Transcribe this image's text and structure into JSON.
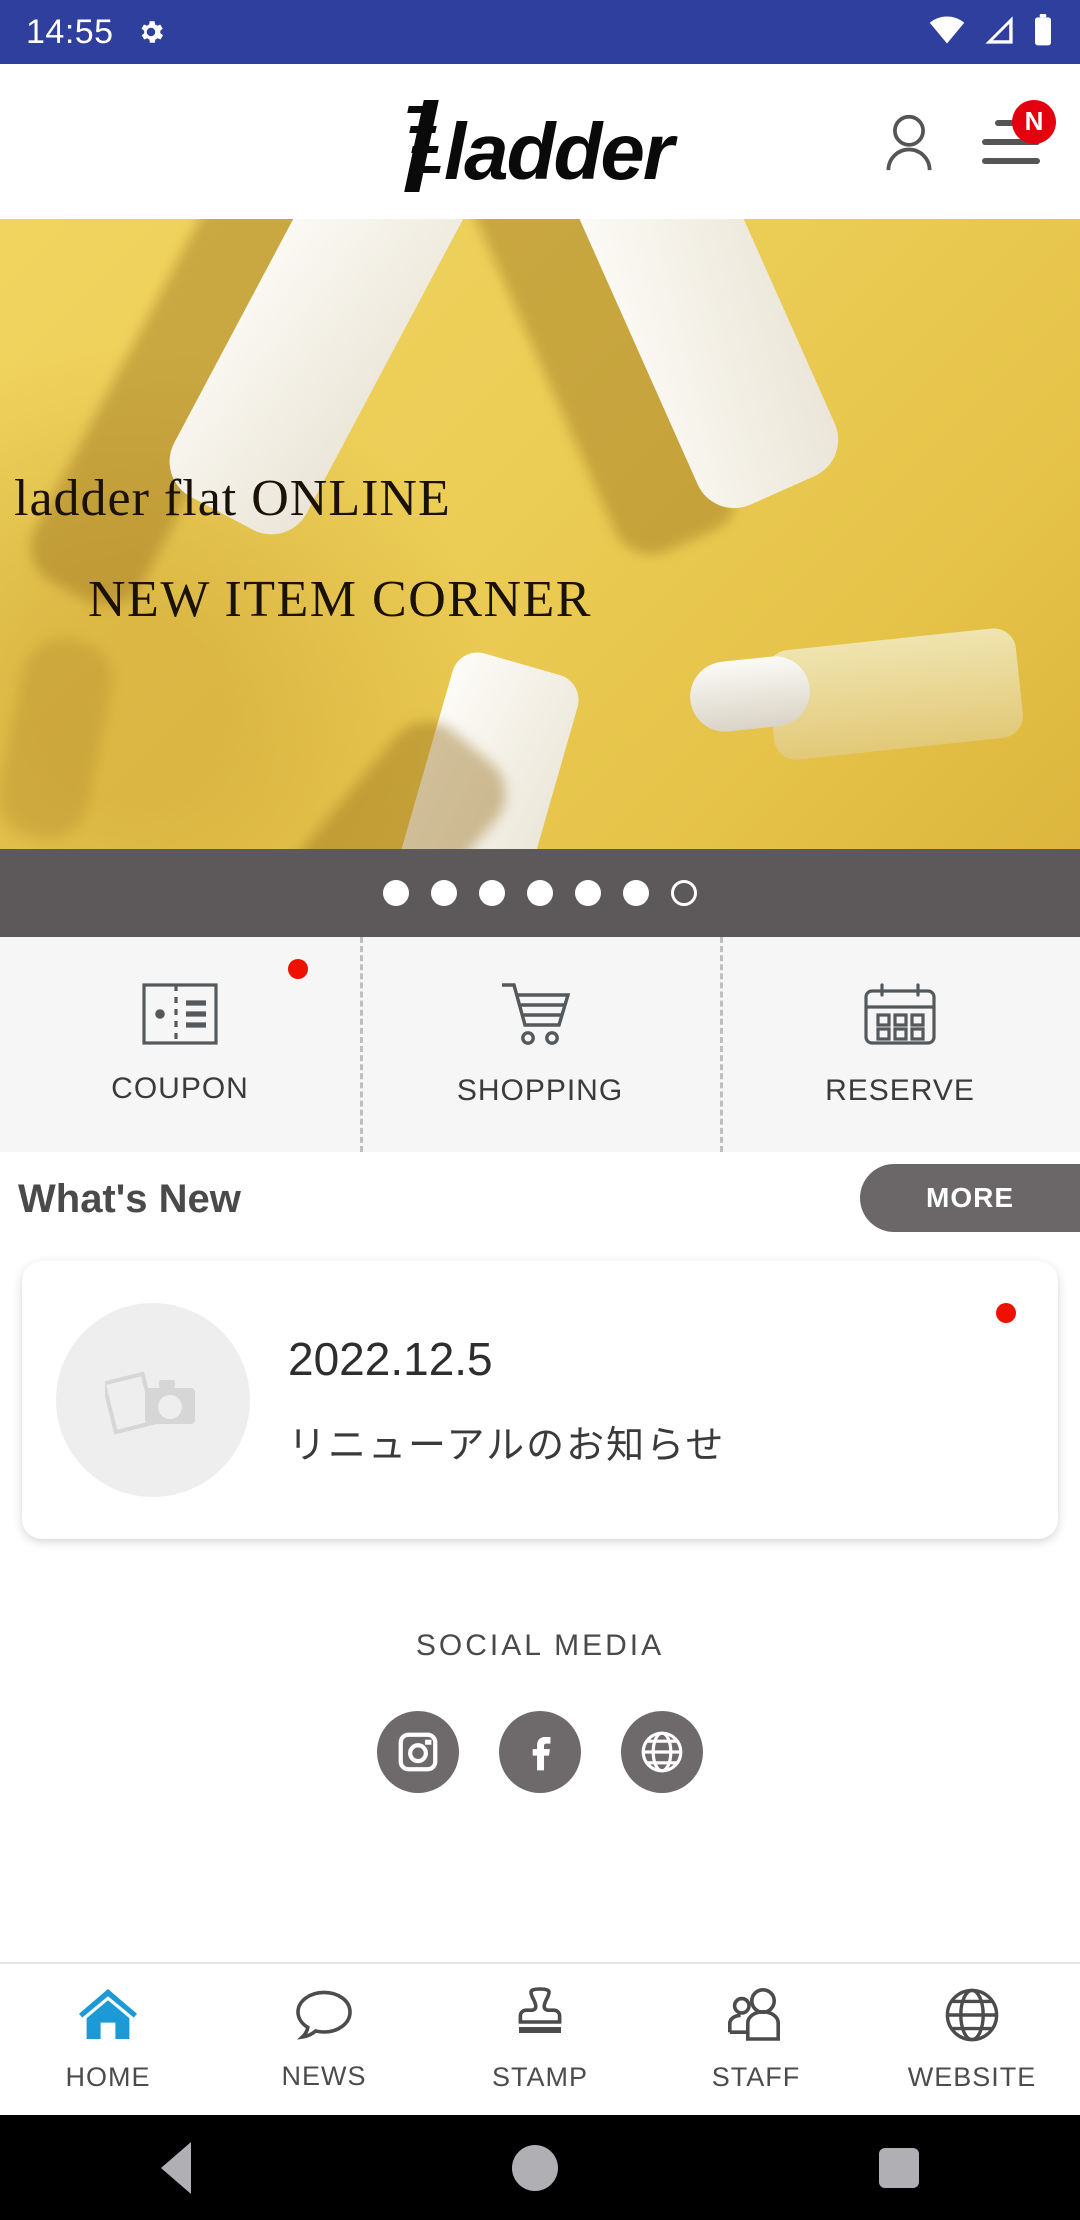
{
  "status_bar": {
    "time": "14:55",
    "gear_icon": "gear-icon",
    "wifi_icon": "wifi-icon",
    "signal_icon": "cellular-signal-icon",
    "battery_icon": "battery-icon",
    "background_color": "#2f3f9e"
  },
  "header": {
    "logo_text": "ladder",
    "account_icon": "person-icon",
    "menu_icon": "hamburger-menu-icon",
    "menu_badge": "N",
    "badge_color": "#e3000f"
  },
  "hero": {
    "line1": "ladder flat ONLINE",
    "line2": "NEW ITEM CORNER",
    "background_color": "#ecce57"
  },
  "carousel": {
    "total_dots": 7,
    "dots": [
      {
        "state": "filled"
      },
      {
        "state": "filled"
      },
      {
        "state": "filled"
      },
      {
        "state": "filled"
      },
      {
        "state": "filled"
      },
      {
        "state": "filled"
      },
      {
        "state": "empty"
      }
    ],
    "bar_color": "#5d585a"
  },
  "quick_actions": [
    {
      "label": "COUPON",
      "icon": "coupon-ticket-icon",
      "has_badge": true
    },
    {
      "label": "SHOPPING",
      "icon": "shopping-cart-icon",
      "has_badge": false
    },
    {
      "label": "RESERVE",
      "icon": "calendar-icon",
      "has_badge": false
    }
  ],
  "whats_new": {
    "title": "What's New",
    "more_label": "MORE",
    "items": [
      {
        "date": "2022.12.5",
        "title": "リニューアルのお知らせ",
        "thumb_icon": "photo-placeholder-icon",
        "has_badge": true
      }
    ]
  },
  "social_media": {
    "label": "SOCIAL MEDIA",
    "items": [
      {
        "name": "instagram-icon"
      },
      {
        "name": "facebook-icon"
      },
      {
        "name": "website-globe-icon"
      }
    ]
  },
  "bottom_nav": {
    "active_color": "#1c9ad6",
    "items": [
      {
        "label": "HOME",
        "icon": "home-icon",
        "active": true
      },
      {
        "label": "NEWS",
        "icon": "speech-bubble-icon",
        "active": false
      },
      {
        "label": "STAMP",
        "icon": "stamp-icon",
        "active": false
      },
      {
        "label": "STAFF",
        "icon": "people-icon",
        "active": false
      },
      {
        "label": "WEBSITE",
        "icon": "globe-icon",
        "active": false
      }
    ]
  },
  "android_nav": {
    "back_icon": "back-triangle-icon",
    "home_icon": "home-circle-icon",
    "recents_icon": "recents-square-icon"
  }
}
